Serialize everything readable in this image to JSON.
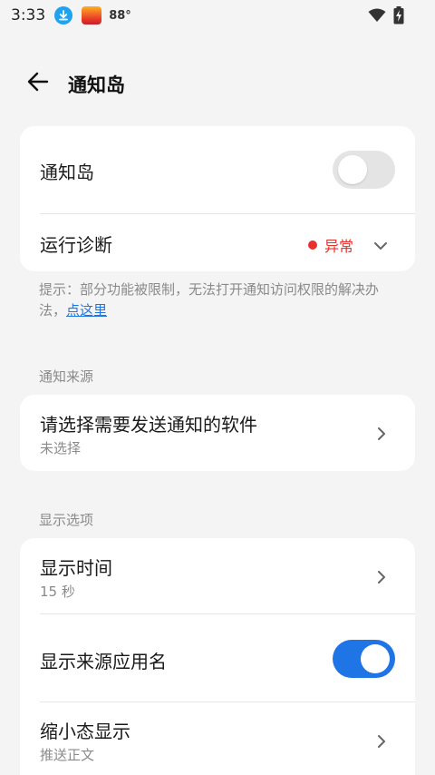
{
  "status_bar": {
    "time": "3:33",
    "temperature": "88°",
    "icons": [
      "download-icon",
      "app-notification-icon",
      "wifi-icon",
      "battery-charging-icon"
    ]
  },
  "header": {
    "back_icon": "arrow-left-icon",
    "title": "通知岛"
  },
  "main_card": {
    "toggle_row": {
      "label": "通知岛",
      "enabled": false
    },
    "diagnose_row": {
      "label": "运行诊断",
      "status": "异常",
      "status_color": "#e8302c"
    }
  },
  "hint": {
    "text": "提示：部分功能被限制，无法打开通知访问权限的解决办法，",
    "link": "点这里"
  },
  "source_section": {
    "label": "通知来源",
    "select_row": {
      "label": "请选择需要发送通知的软件",
      "value": "未选择"
    }
  },
  "display_section": {
    "label": "显示选项",
    "display_time": {
      "label": "显示时间",
      "value": "15 秒"
    },
    "show_app_name": {
      "label": "显示来源应用名",
      "enabled": true
    },
    "compact_display": {
      "label": "缩小态显示",
      "value": "推送正文"
    }
  },
  "colors": {
    "accent": "#1f74e6",
    "background": "#f4f4f4",
    "card": "#ffffff",
    "error": "#e8302c"
  }
}
